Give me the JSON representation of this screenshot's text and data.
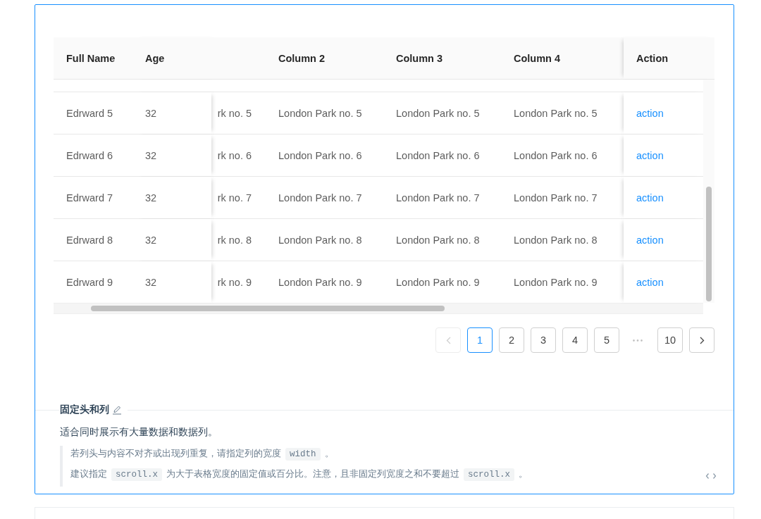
{
  "table": {
    "columns": [
      "Full Name",
      "Age",
      "Column 2",
      "Column 3",
      "Column 4",
      "Action"
    ],
    "rows": [
      {
        "name": "Edrward 5",
        "age": "32",
        "column_1": "rk no. 5",
        "column_2": "London Park no. 5",
        "column_3": "London Park no. 5",
        "column_4": "London Park no. 5",
        "action": "action"
      },
      {
        "name": "Edrward 6",
        "age": "32",
        "column_1": "rk no. 6",
        "column_2": "London Park no. 6",
        "column_3": "London Park no. 6",
        "column_4": "London Park no. 6",
        "action": "action"
      },
      {
        "name": "Edrward 7",
        "age": "32",
        "column_1": "rk no. 7",
        "column_2": "London Park no. 7",
        "column_3": "London Park no. 7",
        "column_4": "London Park no. 7",
        "action": "action"
      },
      {
        "name": "Edrward 8",
        "age": "32",
        "column_1": "rk no. 8",
        "column_2": "London Park no. 8",
        "column_3": "London Park no. 8",
        "column_4": "London Park no. 8",
        "action": "action"
      },
      {
        "name": "Edrward 9",
        "age": "32",
        "column_1": "rk no. 9",
        "column_2": "London Park no. 9",
        "column_3": "London Park no. 9",
        "column_4": "London Park no. 9",
        "action": "action"
      }
    ]
  },
  "pagination": {
    "items": [
      {
        "kind": "prev",
        "disabled": true
      },
      {
        "kind": "page",
        "label": "1",
        "selected": true
      },
      {
        "kind": "page",
        "label": "2",
        "selected": false
      },
      {
        "kind": "page",
        "label": "3",
        "selected": false
      },
      {
        "kind": "page",
        "label": "4",
        "selected": false
      },
      {
        "kind": "page",
        "label": "5",
        "selected": false
      },
      {
        "kind": "ellipsis",
        "label": "•••"
      },
      {
        "kind": "page",
        "label": "10",
        "selected": false
      },
      {
        "kind": "next",
        "disabled": false
      }
    ]
  },
  "demo": {
    "title": "固定头和列",
    "description": "适合同时展示有大量数据和数据列。",
    "notes": [
      [
        {
          "kind": "text",
          "text": "若列头与内容不对齐或出现列重复，请指定列的宽度"
        },
        {
          "kind": "code",
          "text": "width"
        },
        {
          "kind": "text",
          "text": "。"
        }
      ],
      [
        {
          "kind": "text",
          "text": "建议指定"
        },
        {
          "kind": "code",
          "text": "scroll.x"
        },
        {
          "kind": "text",
          "text": "为大于表格宽度的固定值或百分比。注意，且非固定列宽度之和不要超过"
        },
        {
          "kind": "code",
          "text": "scroll.x"
        },
        {
          "kind": "text",
          "text": "。"
        }
      ]
    ]
  }
}
